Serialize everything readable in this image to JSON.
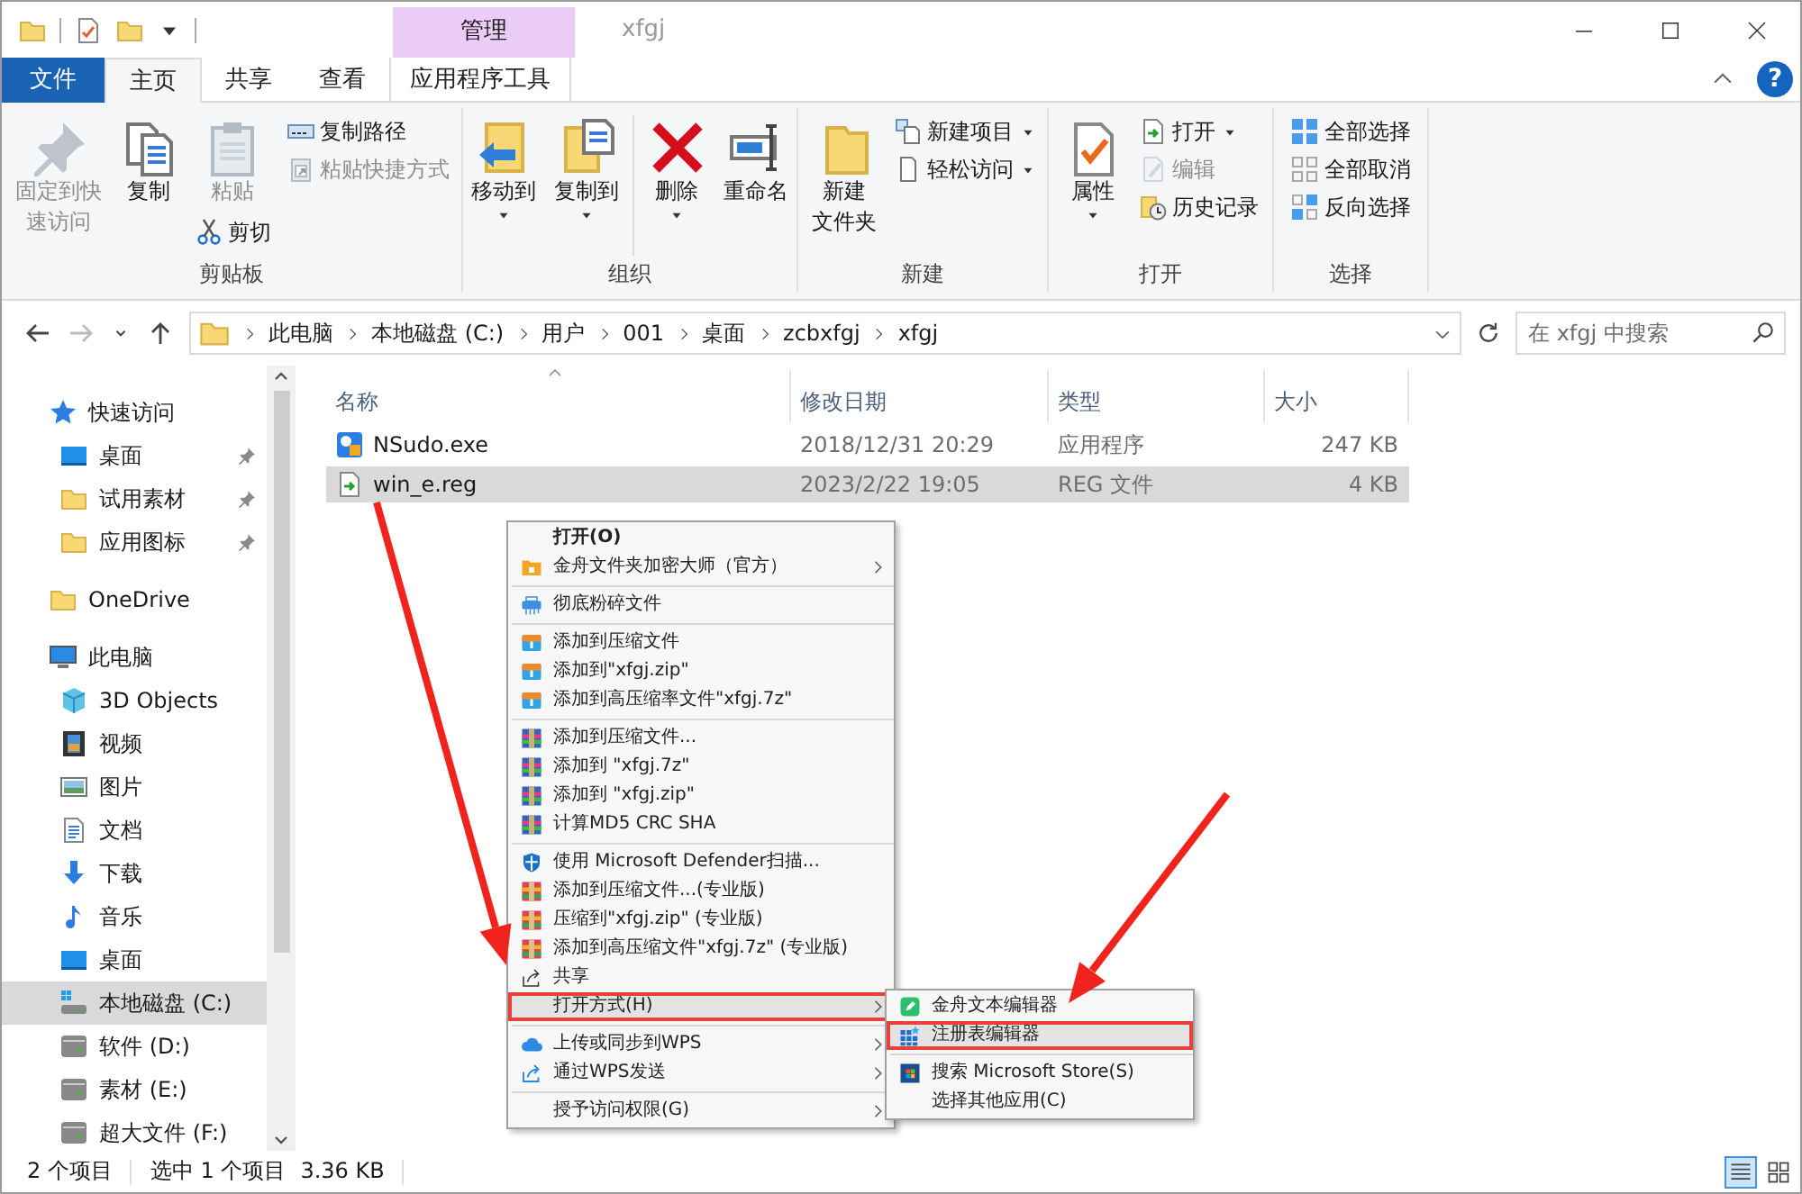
{
  "title_bar": {
    "tab_group": "管理",
    "title": "xfgj"
  },
  "ribbon_tabs": [
    {
      "label": "文件",
      "kind": "file",
      "selected": false
    },
    {
      "label": "主页",
      "kind": "tab",
      "selected": true
    },
    {
      "label": "共享",
      "kind": "tab",
      "selected": false
    },
    {
      "label": "查看",
      "kind": "tab",
      "selected": false
    },
    {
      "label": "应用程序工具",
      "kind": "context",
      "selected": false
    }
  ],
  "help_button": "?",
  "ribbon_groups": [
    {
      "label": "剪贴板",
      "columns": [
        [
          {
            "label": [
              "固定到快",
              "速访问"
            ],
            "kind": "large",
            "disabled": true,
            "dropdown": false
          }
        ],
        [
          {
            "label": "复制",
            "kind": "large",
            "disabled": false,
            "dropdown": false
          }
        ],
        [
          {
            "label": "粘贴",
            "kind": "large",
            "disabled": true,
            "dropdown": false
          },
          {
            "label": "剪切",
            "kind": "small",
            "disabled": false,
            "dropdown": false
          }
        ],
        [
          {
            "label": "复制路径",
            "kind": "small",
            "disabled": false,
            "dropdown": false
          },
          {
            "label": "粘贴快捷方式",
            "kind": "small",
            "disabled": true,
            "dropdown": false
          }
        ]
      ]
    },
    {
      "label": "组织",
      "columns": [
        [
          {
            "label": "移动到",
            "kind": "large",
            "disabled": false,
            "dropdown": true
          }
        ],
        [
          {
            "label": "复制到",
            "kind": "large",
            "disabled": false,
            "dropdown": true
          }
        ],
        [
          {
            "label": "删除",
            "kind": "large",
            "disabled": false,
            "dropdown": true
          }
        ],
        [
          {
            "label": "重命名",
            "kind": "large",
            "disabled": false,
            "dropdown": false
          }
        ]
      ]
    },
    {
      "label": "新建",
      "columns": [
        [
          {
            "label": [
              "新建",
              "文件夹"
            ],
            "kind": "large",
            "disabled": false,
            "dropdown": false
          }
        ],
        [
          {
            "label": "新建项目",
            "kind": "small",
            "disabled": false,
            "dropdown": true
          },
          {
            "label": "轻松访问",
            "kind": "small",
            "disabled": false,
            "dropdown": true
          }
        ]
      ]
    },
    {
      "label": "打开",
      "columns": [
        [
          {
            "label": "属性",
            "kind": "large",
            "disabled": false,
            "dropdown": true
          }
        ],
        [
          {
            "label": "打开",
            "kind": "small",
            "disabled": false,
            "dropdown": true
          },
          {
            "label": "编辑",
            "kind": "small",
            "disabled": true,
            "dropdown": false
          },
          {
            "label": "历史记录",
            "kind": "small",
            "disabled": false,
            "dropdown": false
          }
        ]
      ]
    },
    {
      "label": "选择",
      "columns": [
        [
          {
            "label": "全部选择",
            "kind": "small",
            "disabled": false,
            "dropdown": false
          },
          {
            "label": "全部取消",
            "kind": "small",
            "disabled": false,
            "dropdown": false
          },
          {
            "label": "反向选择",
            "kind": "small",
            "disabled": false,
            "dropdown": false
          }
        ]
      ]
    }
  ],
  "nav_buttons": [
    {
      "kind": "back",
      "disabled": false
    },
    {
      "kind": "forward",
      "disabled": true
    },
    {
      "kind": "recent",
      "disabled": false
    },
    {
      "kind": "up",
      "disabled": false
    }
  ],
  "address_bar": {
    "crumbs": [
      "此电脑",
      "本地磁盘 (C:)",
      "用户",
      "001",
      "桌面",
      "zcbxfgj",
      "xfgj"
    ],
    "search_placeholder": "在 xfgj 中搜索"
  },
  "navigation_pane": {
    "items": [
      {
        "label": "快速访问",
        "kind": "star",
        "selected": false,
        "children": [
          {
            "label": "桌面",
            "kind": "desktop",
            "selected": false,
            "pinned": true
          },
          {
            "label": "试用素材",
            "kind": "folder",
            "selected": false,
            "pinned": true
          },
          {
            "label": "应用图标",
            "kind": "folder",
            "selected": false,
            "pinned": true
          }
        ]
      },
      {
        "label": "OneDrive",
        "kind": "folder",
        "selected": false
      },
      {
        "label": "此电脑",
        "kind": "pc",
        "selected": false,
        "children": [
          {
            "label": "3D Objects",
            "kind": "objects3d",
            "selected": false
          },
          {
            "label": "视频",
            "kind": "video",
            "selected": false
          },
          {
            "label": "图片",
            "kind": "picture",
            "selected": false
          },
          {
            "label": "文档",
            "kind": "document",
            "selected": false
          },
          {
            "label": "下载",
            "kind": "download",
            "selected": false
          },
          {
            "label": "音乐",
            "kind": "music",
            "selected": false
          },
          {
            "label": "桌面",
            "kind": "desktop",
            "selected": false
          },
          {
            "label": "本地磁盘 (C:)",
            "kind": "sysdrive",
            "selected": true
          },
          {
            "label": "软件 (D:)",
            "kind": "drive",
            "selected": false
          },
          {
            "label": "素材 (E:)",
            "kind": "drive",
            "selected": false
          },
          {
            "label": "超大文件 (F:)",
            "kind": "drive",
            "selected": false
          }
        ]
      }
    ]
  },
  "file_list": {
    "columns": [
      "名称",
      "修改日期",
      "类型",
      "大小"
    ],
    "rows": [
      {
        "kind": "exe",
        "selected": false,
        "cells": [
          "NSudo.exe",
          "2018/12/31 20:29",
          "应用程序",
          "247 KB"
        ]
      },
      {
        "kind": "reg",
        "selected": true,
        "cells": [
          "win_e.reg",
          "2023/2/22 19:05",
          "REG 文件",
          "4 KB"
        ]
      }
    ]
  },
  "context_menu": {
    "sections": [
      [
        {
          "label": "打开(O)",
          "kind": "plain",
          "default": true,
          "submenu": false,
          "selected": false
        },
        {
          "label": "金舟文件夹加密大师（官方）",
          "kind": "lock",
          "default": false,
          "submenu": true,
          "selected": false
        }
      ],
      [
        {
          "label": "彻底粉碎文件",
          "kind": "shred",
          "default": false,
          "submenu": false,
          "selected": false
        }
      ],
      [
        {
          "label": "添加到压缩文件",
          "kind": "zip",
          "default": false,
          "submenu": false,
          "selected": false
        },
        {
          "label": "添加到\"xfgj.zip\"",
          "kind": "zip",
          "default": false,
          "submenu": false,
          "selected": false
        },
        {
          "label": "添加到高压缩率文件\"xfgj.7z\"",
          "kind": "zip",
          "default": false,
          "submenu": false,
          "selected": false
        }
      ],
      [
        {
          "label": "添加到压缩文件...",
          "kind": "rar",
          "default": false,
          "submenu": false,
          "selected": false
        },
        {
          "label": "添加到 \"xfgj.7z\"",
          "kind": "rar",
          "default": false,
          "submenu": false,
          "selected": false
        },
        {
          "label": "添加到 \"xfgj.zip\"",
          "kind": "rar",
          "default": false,
          "submenu": false,
          "selected": false
        },
        {
          "label": "计算MD5 CRC SHA",
          "kind": "rar",
          "default": false,
          "submenu": false,
          "selected": false
        }
      ],
      [
        {
          "label": "使用 Microsoft Defender扫描...",
          "kind": "shield",
          "default": false,
          "submenu": false,
          "selected": false
        },
        {
          "label": "添加到压缩文件...(专业版)",
          "kind": "rarpro",
          "default": false,
          "submenu": false,
          "selected": false
        },
        {
          "label": "压缩到\"xfgj.zip\" (专业版)",
          "kind": "rarpro",
          "default": false,
          "submenu": false,
          "selected": false
        },
        {
          "label": "添加到高压缩文件\"xfgj.7z\" (专业版)",
          "kind": "rarpro",
          "default": false,
          "submenu": false,
          "selected": false
        },
        {
          "label": "共享",
          "kind": "share",
          "default": false,
          "submenu": false,
          "selected": false
        },
        {
          "label": "打开方式(H)",
          "kind": "plain",
          "default": false,
          "submenu": true,
          "selected": true
        }
      ],
      [
        {
          "label": "上传或同步到WPS",
          "kind": "cloud",
          "default": false,
          "submenu": true,
          "selected": false
        },
        {
          "label": "通过WPS发送",
          "kind": "send",
          "default": false,
          "submenu": true,
          "selected": false
        }
      ],
      [
        {
          "label": "授予访问权限(G)",
          "kind": "plain",
          "default": false,
          "submenu": true,
          "selected": false
        }
      ]
    ]
  },
  "open_with_menu": {
    "sections": [
      [
        {
          "label": "金舟文本编辑器",
          "kind": "editor",
          "selected": false
        },
        {
          "label": "注册表编辑器",
          "kind": "regedit",
          "selected": true
        }
      ],
      [
        {
          "label": "搜索 Microsoft Store(S)",
          "kind": "store",
          "selected": false
        },
        {
          "label": "选择其他应用(C)",
          "kind": "plain",
          "selected": false
        }
      ]
    ]
  },
  "status_bar": {
    "items": [
      "2 个项目",
      "选中 1 个项目",
      "3.36 KB"
    ],
    "views": [
      {
        "kind": "details",
        "selected": true
      },
      {
        "kind": "thumbnails",
        "selected": false
      }
    ]
  }
}
